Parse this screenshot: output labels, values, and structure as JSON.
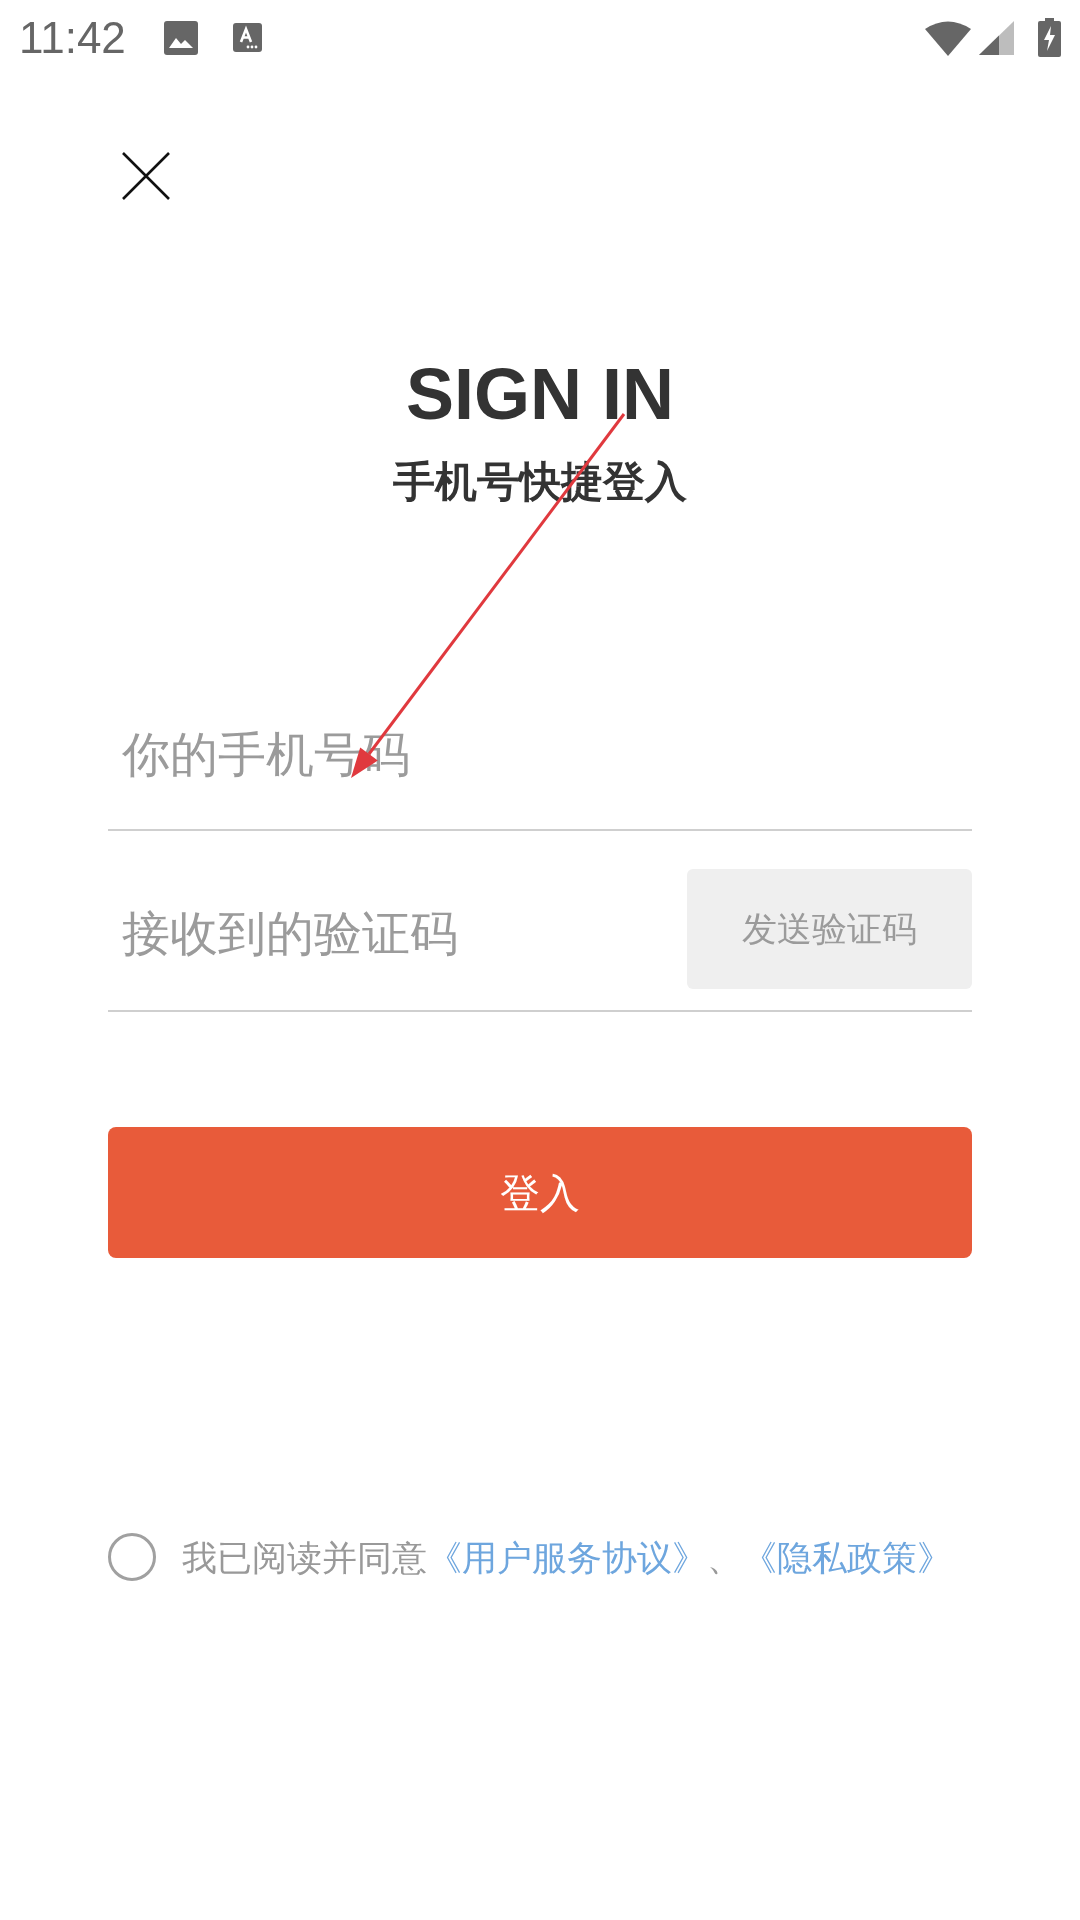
{
  "status_bar": {
    "time": "11:42"
  },
  "header": {
    "title": "SIGN IN",
    "subtitle": "手机号快捷登入"
  },
  "form": {
    "phone_field": {
      "placeholder": "你的手机号码"
    },
    "code_field": {
      "placeholder": "接收到的验证码"
    },
    "send_code_button": {
      "label": "发送验证码",
      "disabled": true
    },
    "submit_button": {
      "label": "登入"
    }
  },
  "agreement": {
    "checked": false,
    "parts": [
      {
        "kind": "text",
        "text": "我已阅读并同意"
      },
      {
        "kind": "link",
        "text": "《用户服务协议》"
      },
      {
        "kind": "text",
        "text": "、"
      },
      {
        "kind": "link",
        "text": "《隐私政策》"
      }
    ]
  }
}
